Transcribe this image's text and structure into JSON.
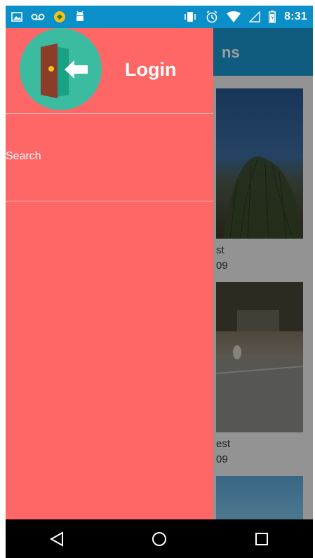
{
  "status_bar": {
    "time": "8:31",
    "left_icons": [
      "image-icon",
      "voicemail-icon",
      "sync-badge-icon",
      "android-icon"
    ],
    "right_icons": [
      "vibrate-icon",
      "alarm-icon",
      "wifi-icon",
      "signal-icon",
      "battery-icon"
    ]
  },
  "app": {
    "toolbar_title_fragment": "ns",
    "cards": [
      {
        "caption_line1": "st",
        "caption_line2": "09",
        "photo": "tree-sky"
      },
      {
        "caption_line1": "est",
        "caption_line2": "09",
        "photo": "street"
      }
    ]
  },
  "drawer": {
    "header_label": "Login",
    "avatar_icon": "login-door-icon",
    "menu_items": [
      {
        "label": "Search"
      }
    ],
    "background_color": "#ff6666",
    "avatar_color": "#3bbba0"
  },
  "nav_bar": {
    "buttons": [
      "back-icon",
      "home-icon",
      "recents-icon"
    ]
  }
}
